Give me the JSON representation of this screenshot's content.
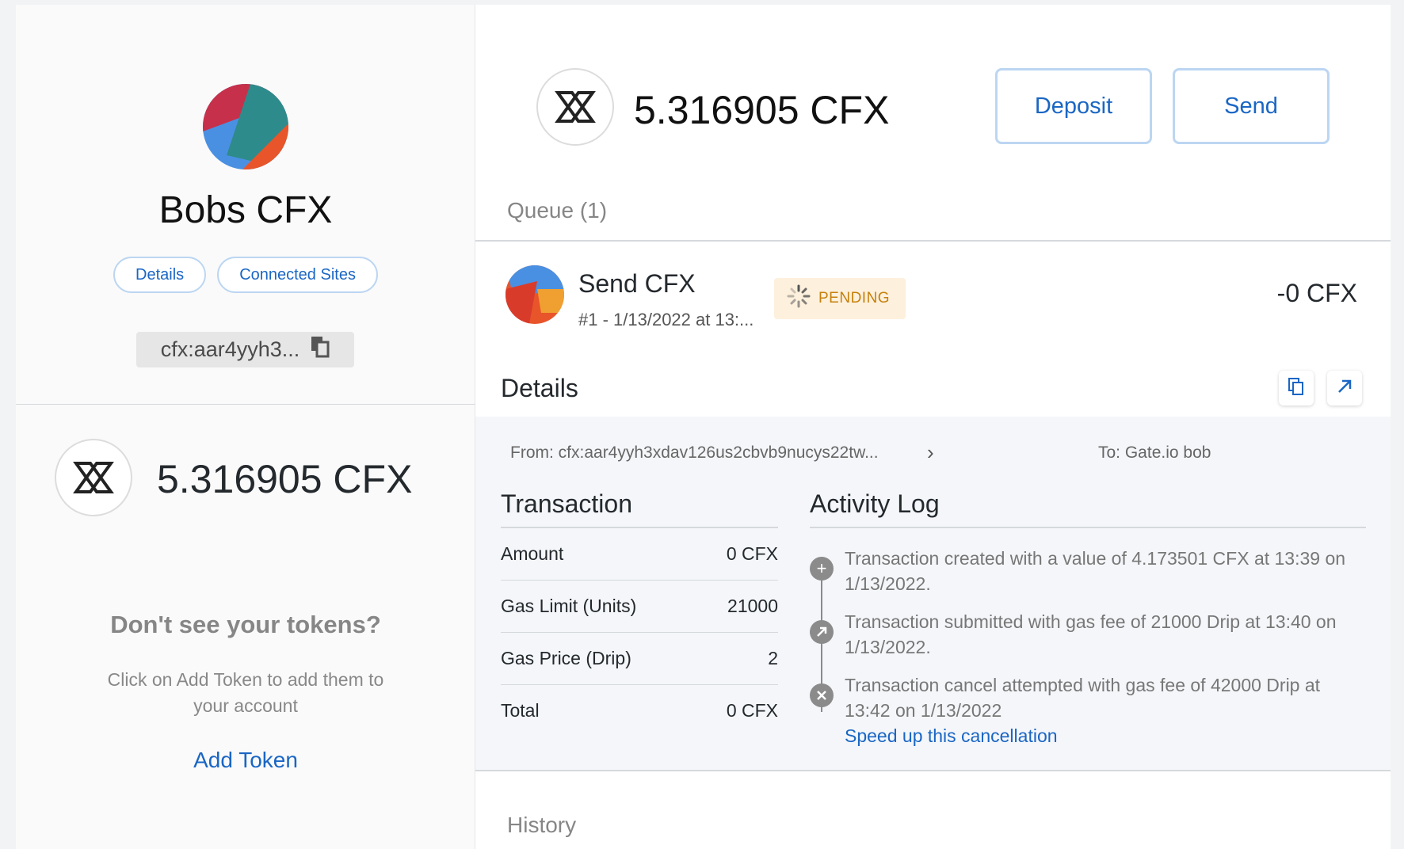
{
  "account": {
    "name": "Bobs CFX",
    "details_label": "Details",
    "connected_sites_label": "Connected Sites",
    "address_short": "cfx:aar4yyh3..."
  },
  "sidebar": {
    "balance": "5.316905 CFX",
    "no_tokens_title": "Don't see your tokens?",
    "no_tokens_text": "Click on Add Token to add them to your account",
    "add_token_label": "Add Token"
  },
  "main": {
    "balance": "5.316905 CFX",
    "deposit_label": "Deposit",
    "send_label": "Send",
    "queue_title": "Queue (1)",
    "history_title": "History"
  },
  "transaction": {
    "title": "Send CFX",
    "subtitle": "#1 - 1/13/2022 at 13:...",
    "status": "PENDING",
    "amount": "-0 CFX"
  },
  "details": {
    "title": "Details",
    "from": "From: cfx:aar4yyh3xdav126us2cbvb9nucys22tw...",
    "to": "To: Gate.io bob",
    "tx_section_title": "Transaction",
    "rows": [
      {
        "label": "Amount",
        "value": "0 CFX"
      },
      {
        "label": "Gas Limit (Units)",
        "value": "21000"
      },
      {
        "label": "Gas Price (Drip)",
        "value": "2"
      },
      {
        "label": "Total",
        "value": "0 CFX"
      }
    ],
    "log_title": "Activity Log",
    "log": [
      {
        "icon": "plus-icon",
        "text": "Transaction created with a value of 4.173501 CFX at 13:39 on 1/13/2022."
      },
      {
        "icon": "arrow-up-right-icon",
        "text": "Transaction submitted with gas fee of 21000 Drip at 13:40 on 1/13/2022."
      },
      {
        "icon": "x-icon",
        "text": "Transaction cancel attempted with gas fee of 42000 Drip at 13:42 on 1/13/2022"
      }
    ],
    "speed_up_label": "Speed up this cancellation"
  }
}
